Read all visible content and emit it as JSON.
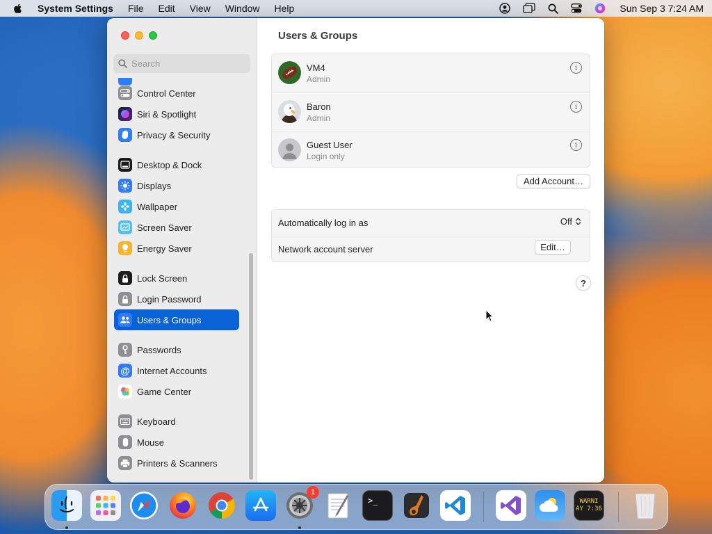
{
  "menubar": {
    "app_name": "System Settings",
    "menus": [
      "File",
      "Edit",
      "View",
      "Window",
      "Help"
    ],
    "clock": "Sun Sep 3  7:24 AM"
  },
  "sidebar": {
    "search_placeholder": "Search",
    "items": [
      {
        "label": "Control Center",
        "icon": "control-center-icon",
        "color": "#8e8e93",
        "selected": false
      },
      {
        "label": "Siri & Spotlight",
        "icon": "siri-icon",
        "color": "#6a3de8",
        "selected": false
      },
      {
        "label": "Privacy & Security",
        "icon": "hand-icon",
        "color": "#2f7cf6",
        "selected": false
      },
      {
        "label": "Desktop & Dock",
        "icon": "desktop-icon",
        "color": "#1c1c1e",
        "selected": false
      },
      {
        "label": "Displays",
        "icon": "sun-icon",
        "color": "#2f7cf6",
        "selected": false
      },
      {
        "label": "Wallpaper",
        "icon": "flower-icon",
        "color": "#3fb3f0",
        "selected": false
      },
      {
        "label": "Screen Saver",
        "icon": "screen-saver-icon",
        "color": "#57c0e8",
        "selected": false
      },
      {
        "label": "Energy Saver",
        "icon": "bulb-icon",
        "color": "#f6b42c",
        "selected": false
      },
      {
        "label": "Lock Screen",
        "icon": "lock-icon",
        "color": "#1c1c1e",
        "selected": false
      },
      {
        "label": "Login Password",
        "icon": "lock-icon",
        "color": "#8e8e93",
        "selected": false
      },
      {
        "label": "Users & Groups",
        "icon": "users-icon",
        "color": "#2f7cf6",
        "selected": true
      },
      {
        "label": "Passwords",
        "icon": "key-icon",
        "color": "#8e8e93",
        "selected": false
      },
      {
        "label": "Internet Accounts",
        "icon": "at-icon",
        "color": "#2f7cf6",
        "selected": false
      },
      {
        "label": "Game Center",
        "icon": "game-center-icon",
        "color": "#e94b8a",
        "selected": false
      },
      {
        "label": "Keyboard",
        "icon": "keyboard-icon",
        "color": "#8e8e93",
        "selected": false
      },
      {
        "label": "Mouse",
        "icon": "mouse-icon",
        "color": "#8e8e93",
        "selected": false
      },
      {
        "label": "Printers & Scanners",
        "icon": "printer-icon",
        "color": "#8e8e93",
        "selected": false
      }
    ]
  },
  "main": {
    "title": "Users & Groups",
    "users": [
      {
        "name": "VM4",
        "role": "Admin",
        "avatar": "football-avatar"
      },
      {
        "name": "Baron",
        "role": "Admin",
        "avatar": "eagle-avatar"
      },
      {
        "name": "Guest User",
        "role": "Login only",
        "avatar": "guest-avatar"
      }
    ],
    "add_account_label": "Add Account…",
    "auto_login_label": "Automatically log in as",
    "auto_login_value": "Off",
    "network_server_label": "Network account server",
    "edit_label": "Edit…",
    "help_label": "?"
  },
  "dock": {
    "apps": [
      "Finder",
      "Launchpad",
      "Safari",
      "Firefox",
      "Chrome",
      "App Store",
      "System Settings",
      "TextEdit",
      "Terminal",
      "GarageBand",
      "Visual Studio Code",
      "Visual Studio",
      "Weather",
      "Console",
      "Trash"
    ],
    "settings_badge": "1",
    "console_text_line1": "WARNI",
    "console_text_line2": "AY 7:36"
  }
}
